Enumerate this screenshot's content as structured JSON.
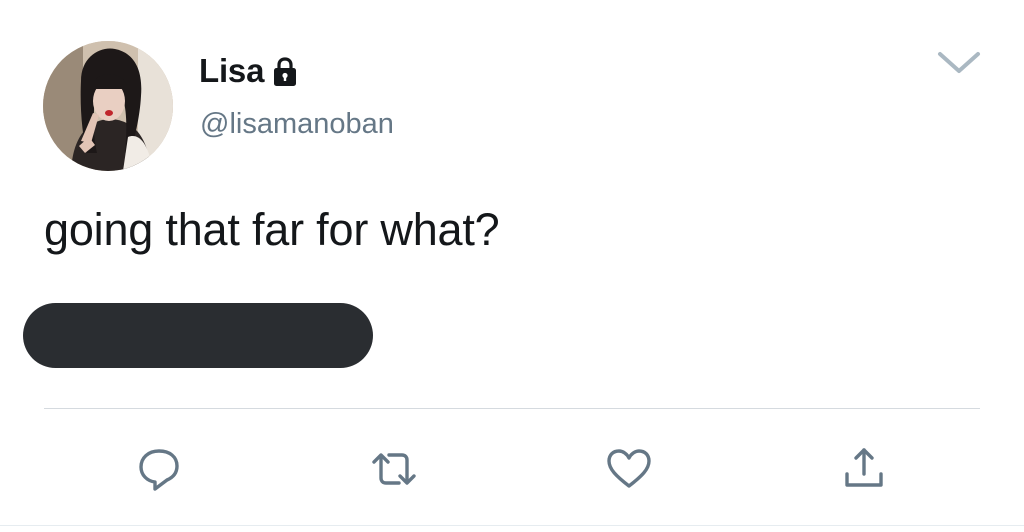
{
  "tweet": {
    "display_name": "Lisa",
    "handle": "@lisamanoban",
    "text": "going that far for what?",
    "protected": true
  },
  "icons": {
    "lock": "lock-icon",
    "menu": "chevron-down-icon",
    "reply": "reply-icon",
    "retweet": "retweet-icon",
    "like": "heart-icon",
    "share": "share-icon"
  },
  "colors": {
    "text": "#14171a",
    "secondary_text": "#657786",
    "icon": "#657786",
    "redaction": "#2a2d31",
    "divider": "#d5dadf",
    "background": "#ffffff"
  }
}
